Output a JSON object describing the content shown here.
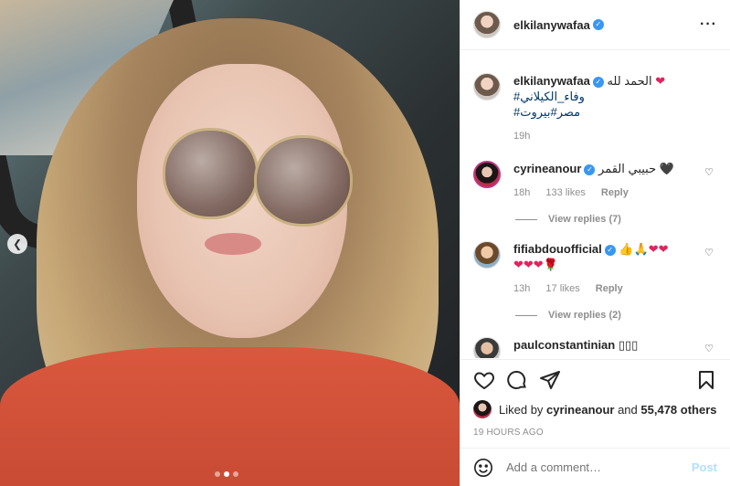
{
  "header": {
    "username": "elkilanywafaa",
    "more_icon": "more-horizontal-icon"
  },
  "caption": {
    "username": "elkilanywafaa",
    "text": "الحمد لله",
    "heart": "❤",
    "hashtags": [
      "#وفاء_الكيلاني",
      "#مصر#بيروت"
    ],
    "time": "19h"
  },
  "comments": [
    {
      "username": "cyrineanour",
      "text": "حبيبي القمر 🖤",
      "time": "18h",
      "likes": "133 likes",
      "reply_label": "Reply",
      "view_replies": "View replies (7)"
    },
    {
      "username": "fifiabdouofficial",
      "text": "👍🙏❤❤",
      "text_line2": "❤❤❤🌹",
      "time": "13h",
      "likes": "17 likes",
      "reply_label": "Reply",
      "view_replies": "View replies (2)"
    },
    {
      "username": "paulconstantinian",
      "text": "▯▯▯"
    }
  ],
  "actions": {
    "liked_by_prefix": "Liked by ",
    "liked_by_user": "cyrineanour",
    "liked_by_mid": " and ",
    "liked_by_count": "55,478 others",
    "timestamp": "19 HOURS AGO"
  },
  "add_comment": {
    "placeholder": "Add a comment…",
    "post_label": "Post"
  },
  "colors": {
    "link": "#00376b",
    "verified": "#3897f0",
    "post_disabled": "#b2dffc"
  }
}
